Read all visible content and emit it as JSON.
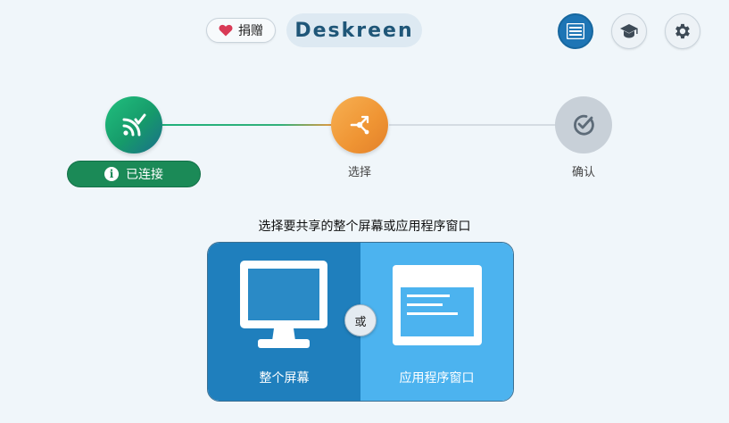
{
  "header": {
    "donate_label": "捐赠",
    "logo_text": "Deskreen",
    "menu_icon": "menu-icon",
    "learn_icon": "graduation-cap-icon",
    "settings_icon": "gear-icon"
  },
  "stepper": {
    "steps": [
      {
        "label": "已连接",
        "icon": "cast-connected-icon",
        "status": "done"
      },
      {
        "label": "选择",
        "icon": "share-icon",
        "status": "active"
      },
      {
        "label": "确认",
        "icon": "check-circle-icon",
        "status": "pending"
      }
    ]
  },
  "main": {
    "prompt": "选择要共享的整个屏幕或应用程序窗口",
    "or_label": "或",
    "options": [
      {
        "label": "整个屏幕",
        "icon": "monitor-icon"
      },
      {
        "label": "应用程序窗口",
        "icon": "app-window-icon"
      }
    ]
  },
  "colors": {
    "accent": "#1e75b5",
    "success": "#1b8a57",
    "active_step": "#ef9433",
    "pending_step": "#c8d0d8",
    "option_left": "#1f7fbd",
    "option_right": "#4cb3ef",
    "background": "#f0f6fa"
  }
}
